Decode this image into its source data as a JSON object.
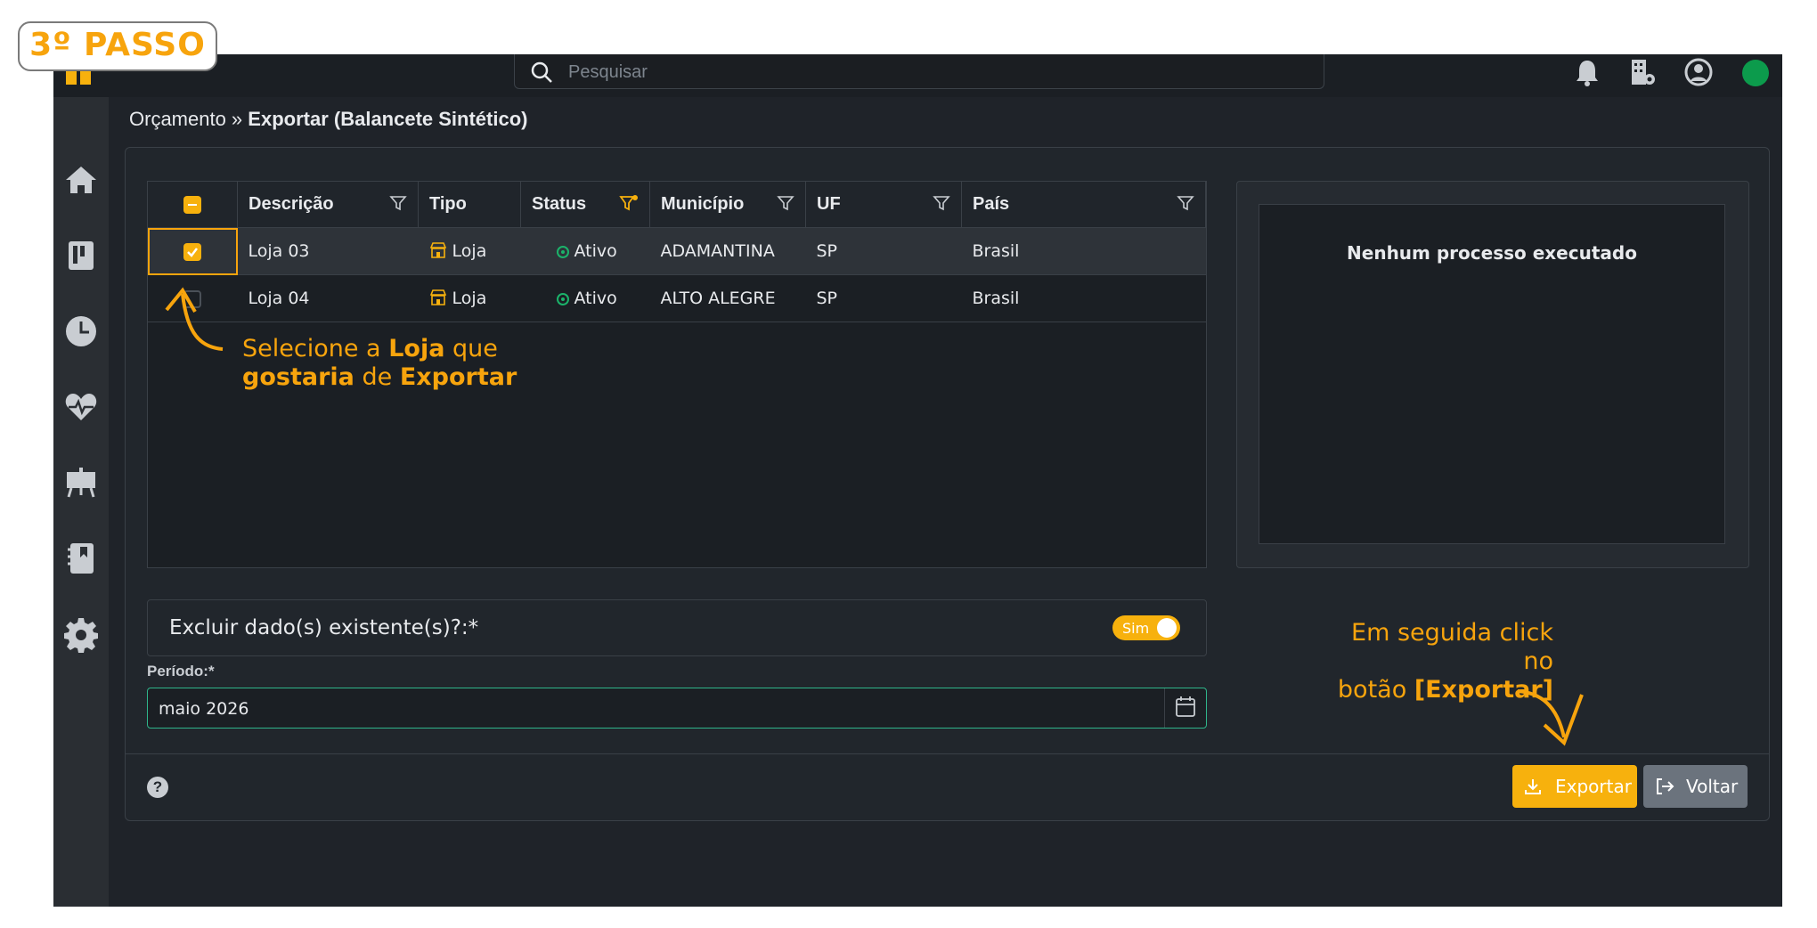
{
  "step_badge": "3º PASSO",
  "search": {
    "placeholder": "Pesquisar"
  },
  "breadcrumb": {
    "parent": "Orçamento »",
    "current": "Exportar (Balancete Sintético)"
  },
  "grid": {
    "columns": [
      "Descrição",
      "Tipo",
      "Status",
      "Município",
      "UF",
      "País"
    ],
    "rows": [
      {
        "descricao": "Loja 03",
        "tipo": "Loja",
        "status": "Ativo",
        "municipio": "ADAMANTINA",
        "uf": "SP",
        "pais": "Brasil",
        "selected": true
      },
      {
        "descricao": "Loja 04",
        "tipo": "Loja",
        "status": "Ativo",
        "municipio": "ALTO ALEGRE",
        "uf": "SP",
        "pais": "Brasil",
        "selected": false
      }
    ]
  },
  "process_panel": {
    "message": "Nenhum processo executado"
  },
  "excluir": {
    "label": "Excluir dado(s) existente(s)?:*",
    "toggle_text": "Sim"
  },
  "periodo": {
    "label": "Período:*",
    "value": "maio 2026"
  },
  "footer": {
    "help": "?",
    "export_label": "Exportar",
    "back_label": "Voltar"
  },
  "annotations": {
    "select_line1_a": "Selecione a",
    "select_line1_b": "Loja",
    "select_line1_c": "que",
    "select_line2_a": "gostaria",
    "select_line2_b": "de",
    "select_line2_c": "Exportar",
    "export_line1": "Em seguida click no",
    "export_line2_a": "botão",
    "export_line2_b": "[Exportar]"
  },
  "colors": {
    "accent": "#f7b10d",
    "background": "#1f2329",
    "status_ok": "#1bb36a",
    "online": "#0c9b4c"
  }
}
